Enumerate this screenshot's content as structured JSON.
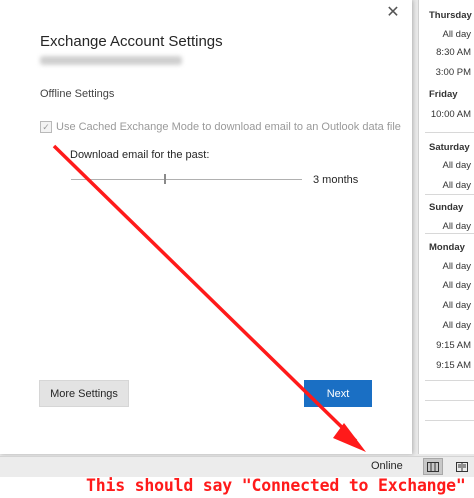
{
  "dialog": {
    "close_glyph": "✕",
    "title": "Exchange Account Settings",
    "section_label": "Offline Settings",
    "cached_mode": {
      "label": "Use Cached Exchange Mode to download email to an Outlook data file",
      "checked": true,
      "disabled": true
    },
    "download_label": "Download email for the past:",
    "slider_value": "3 months",
    "more_settings_label": "More Settings",
    "next_label": "Next",
    "accent_color": "#1a6fc4"
  },
  "calendar": {
    "entries": [
      {
        "type": "day",
        "text": "Thursday"
      },
      {
        "type": "item",
        "text": "All day"
      },
      {
        "type": "item",
        "text": "8:30 AM"
      },
      {
        "type": "item",
        "text": "3:00 PM"
      },
      {
        "type": "day",
        "text": "Friday"
      },
      {
        "type": "item",
        "text": "10:00 AM"
      },
      {
        "type": "day",
        "text": "Saturday"
      },
      {
        "type": "item",
        "text": "All day"
      },
      {
        "type": "item",
        "text": "All day"
      },
      {
        "type": "day",
        "text": "Sunday"
      },
      {
        "type": "item",
        "text": "All day"
      },
      {
        "type": "day",
        "text": "Monday"
      },
      {
        "type": "item",
        "text": "All day"
      },
      {
        "type": "item",
        "text": "All day"
      },
      {
        "type": "item",
        "text": "All day"
      },
      {
        "type": "item",
        "text": "All day"
      },
      {
        "type": "item",
        "text": "9:15 AM"
      },
      {
        "type": "item",
        "text": "9:15 AM"
      }
    ]
  },
  "statusbar": {
    "connection_status": "Online",
    "view_icons": [
      "normal-view-icon",
      "reading-view-icon"
    ]
  },
  "annotation": {
    "text": "This should say \"Connected to Exchange\"",
    "color": "#ff1a1a"
  }
}
